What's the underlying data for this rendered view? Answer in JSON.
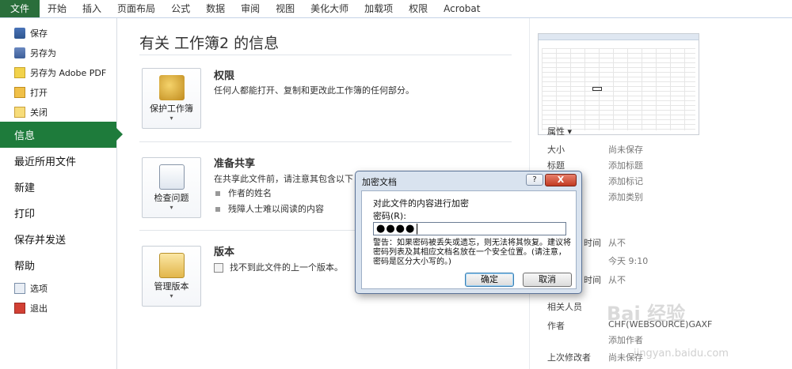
{
  "ribbon": {
    "tabs": [
      "文件",
      "开始",
      "插入",
      "页面布局",
      "公式",
      "数据",
      "审阅",
      "视图",
      "美化大师",
      "加载项",
      "权限",
      "Acrobat"
    ]
  },
  "nav": {
    "small_top": [
      {
        "label": "保存",
        "icon": "save-icon"
      },
      {
        "label": "另存为",
        "icon": "save-as-icon"
      },
      {
        "label": "另存为 Adobe PDF",
        "icon": "pdf-icon"
      },
      {
        "label": "打开",
        "icon": "folder-open-icon"
      },
      {
        "label": "关闭",
        "icon": "close-file-icon"
      }
    ],
    "big": [
      "信息",
      "最近所用文件",
      "新建",
      "打印",
      "保存并发送",
      "帮助"
    ],
    "active": "信息",
    "small_bottom": [
      {
        "label": "选项",
        "icon": "options-icon"
      },
      {
        "label": "退出",
        "icon": "exit-icon"
      }
    ]
  },
  "main": {
    "title": "有关 工作簿2 的信息",
    "permissions": {
      "button": "保护工作簿",
      "title": "权限",
      "text": "任何人都能打开、复制和更改此工作簿的任何部分。"
    },
    "share": {
      "button": "检查问题",
      "title": "准备共享",
      "text": "在共享此文件前，请注意其包含以下",
      "bullets": [
        "作者的姓名",
        "残障人士难以阅读的内容"
      ]
    },
    "versions": {
      "button": "管理版本",
      "title": "版本",
      "text": "找不到此文件的上一个版本。"
    }
  },
  "right": {
    "properties_header": "属性 ▾",
    "rows": [
      {
        "label": "大小",
        "value": "尚未保存"
      },
      {
        "label": "标题",
        "value": "添加标题"
      },
      {
        "label": "标记",
        "value": "添加标记"
      },
      {
        "label": "类别",
        "value": "添加类别"
      }
    ],
    "dates": [
      {
        "label": "时间",
        "value": "从不"
      },
      {
        "label": "",
        "value": "今天 9:10"
      },
      {
        "label": "时间",
        "value": "从不"
      }
    ],
    "related_people": "相关人员",
    "author_label": "作者",
    "author_value": "CHF(WEBSOURCE)GAXF",
    "add_author": "添加作者",
    "last_modified_label": "上次修改者",
    "last_modified_value": "尚未保存"
  },
  "dialog": {
    "title": "加密文档",
    "help": "?",
    "close": "X",
    "heading": "对此文件的内容进行加密",
    "password_label": "密码(R):",
    "password_value": "●●●●|",
    "warning": "警告：如果密码被丢失或遗忘，则无法将其恢复。建议将密码列表及其相应文档名放在一个安全位置。(请注意，密码是区分大小写的。)",
    "ok": "确定",
    "cancel": "取消"
  },
  "watermark": {
    "text": "Bai 经验",
    "url": "jingyan.baidu.com"
  },
  "colors": {
    "file_tab": "#2a6e3b",
    "active_nav": "#1e7b3b"
  }
}
